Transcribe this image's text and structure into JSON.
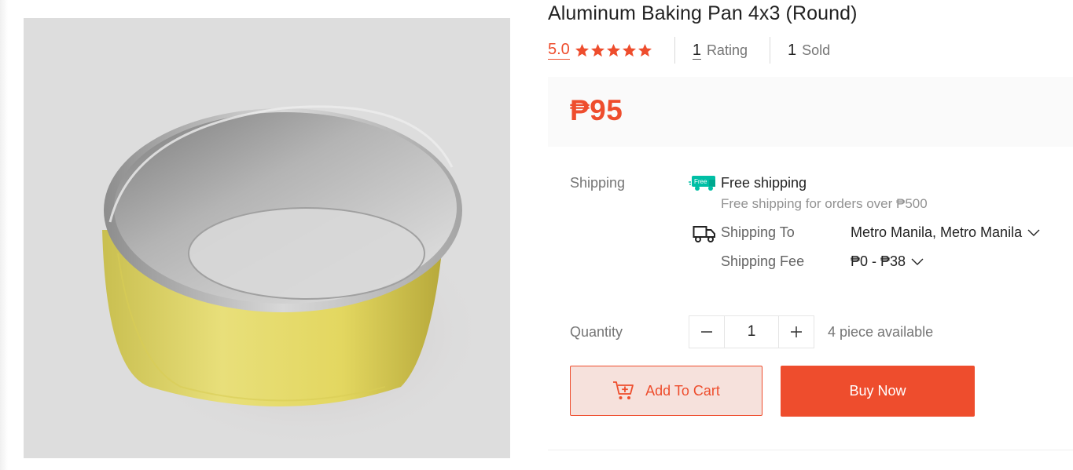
{
  "product": {
    "title": "Aluminum Baking Pan 4x3 (Round)",
    "image_alt": "Aluminum round baking pan"
  },
  "stats": {
    "rating_score": "5.0",
    "stars": 5,
    "ratings_count": "1",
    "ratings_label": "Rating",
    "sold_count": "1",
    "sold_label": "Sold"
  },
  "price": {
    "value": "₱95"
  },
  "shipping": {
    "label": "Shipping",
    "free_badge": "Free",
    "free_title": "Free shipping",
    "free_subtitle": "Free shipping for orders over ₱500",
    "ship_to_label": "Shipping To",
    "ship_to_value": "Metro Manila, Metro Manila",
    "fee_label": "Shipping Fee",
    "fee_value": "₱0 - ₱38"
  },
  "quantity": {
    "label": "Quantity",
    "value": "1",
    "stock": "4 piece available"
  },
  "actions": {
    "add_to_cart": "Add To Cart",
    "buy_now": "Buy Now"
  },
  "colors": {
    "accent": "#ee4d2d",
    "accent_light": "#f6e1dc",
    "free_badge": "#00bfa5",
    "price_bg": "#fafafa"
  }
}
